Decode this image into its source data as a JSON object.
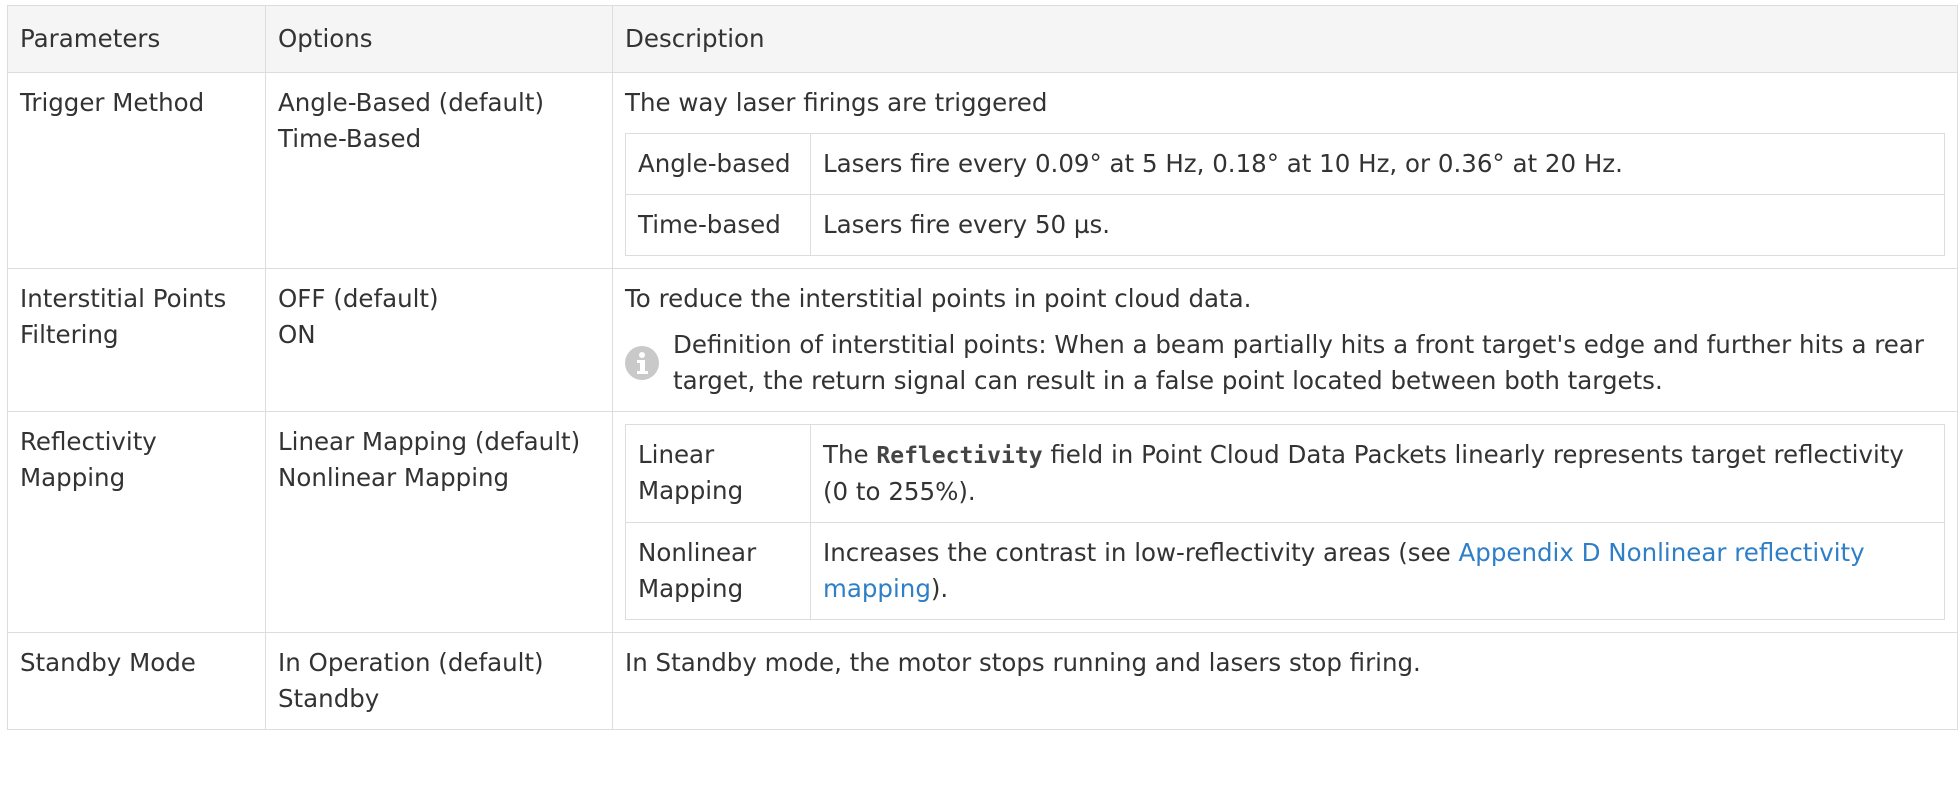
{
  "headers": {
    "parameters": "Parameters",
    "options": "Options",
    "description": "Description"
  },
  "rows": {
    "trigger": {
      "parameter": "Trigger Method",
      "options": [
        "Angle-Based (default)",
        "Time-Based"
      ],
      "description": "The way laser firings are triggered",
      "subtable": [
        {
          "label": "Angle-based",
          "text": "Lasers fire every 0.09° at 5 Hz, 0.18° at 10 Hz, or 0.36° at 20 Hz."
        },
        {
          "label": "Time-based",
          "text": "Lasers fire every 50 µs."
        }
      ]
    },
    "interstitial": {
      "parameter": "Interstitial Points Filtering",
      "options": [
        "OFF (default)",
        "ON"
      ],
      "description": "To reduce the interstitial points in point cloud data.",
      "note": "Definition of interstitial points: When a beam partially hits a front target's edge and further hits a rear target, the return signal can result in a false point located between both targets."
    },
    "reflectivity": {
      "parameter": "Reflectivity Mapping",
      "options": [
        "Linear Mapping (default)",
        "Nonlinear Mapping"
      ],
      "subtable": [
        {
          "label": "Linear Mapping",
          "text_before": "The",
          "code": "Reflectivity",
          "text_after": "field in Point Cloud Data Packets linearly represents target reflectivity (0 to 255%)."
        },
        {
          "label": "Nonlinear Mapping",
          "text_before": "Increases the contrast in low-reflectivity areas (see",
          "link": "Appendix D Nonlinear reflectivity mapping",
          "text_after": ")."
        }
      ]
    },
    "standby": {
      "parameter": "Standby Mode",
      "options": [
        "In Operation (default)",
        "Standby"
      ],
      "description": "In Standby mode, the motor stops running and lasers stop firing."
    }
  },
  "colors": {
    "border": "#dddddd",
    "header_bg": "#f5f5f5",
    "link": "#2f7fc8",
    "note_icon": "#c9c9c9"
  },
  "icons": {
    "note": "info-icon"
  }
}
